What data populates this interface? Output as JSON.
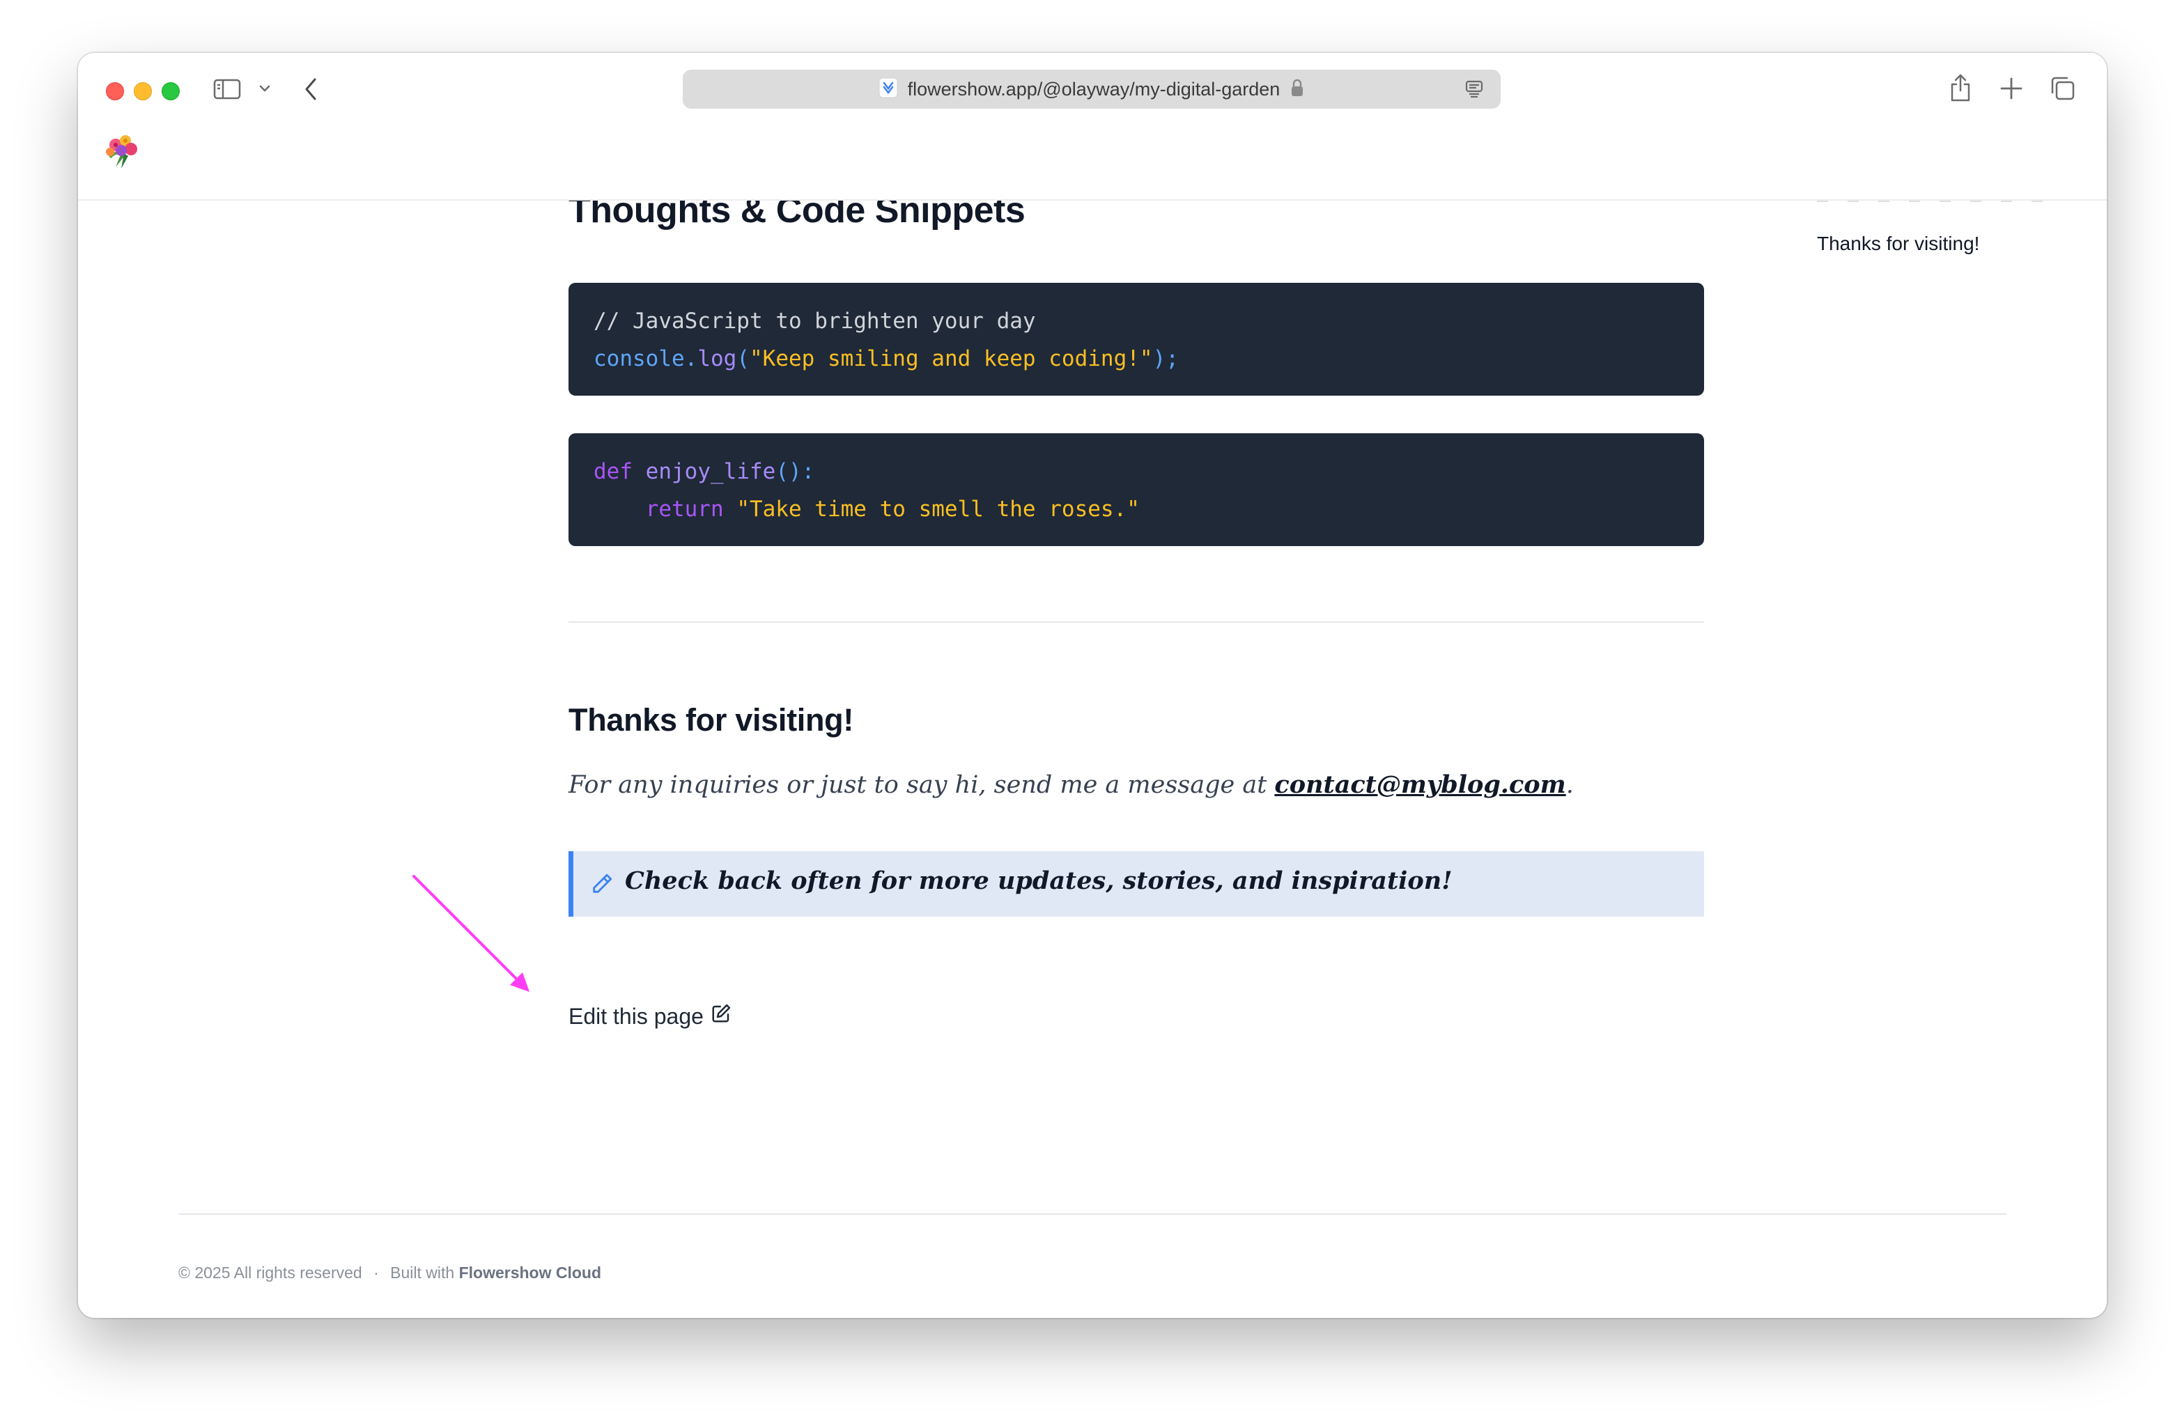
{
  "browser": {
    "url": "flowershow.app/@olayway/my-digital-garden"
  },
  "page": {
    "section_heading": "Thoughts & Code Snippets",
    "code_blocks": [
      {
        "line1_comment": "// JavaScript to brighten your day",
        "line2_object": "console",
        "line2_dot": ".",
        "line2_method": "log",
        "line2_open": "(",
        "line2_string": "\"Keep smiling and keep coding!\"",
        "line2_close": ");"
      },
      {
        "line1_keyword": "def",
        "line1_fn": "enjoy_life",
        "line1_rest": "():",
        "line2_indent": "    ",
        "line2_keyword": "return",
        "line2_string": "\"Take time to smell the roses.\""
      }
    ],
    "thanks_heading": "Thanks for visiting!",
    "inquiry_text": "For any inquiries or just to say hi, send me a message at ",
    "email_link": "contact@myblog.com",
    "inquiry_end": ".",
    "callout_text": "Check back often for more updates, stories, and inspiration!",
    "edit_link": "Edit this page"
  },
  "toc": {
    "current_item": "Thanks for visiting!"
  },
  "footer": {
    "copyright": "© 2025 All rights reserved",
    "separator": "·",
    "built_with_prefix": "Built with",
    "built_with_name": "Flowershow Cloud"
  },
  "colors": {
    "annotation_arrow": "#ff3df5",
    "code_background": "#1f2937",
    "callout_accent": "#3b82f6",
    "callout_background": "#e1e8f5"
  }
}
